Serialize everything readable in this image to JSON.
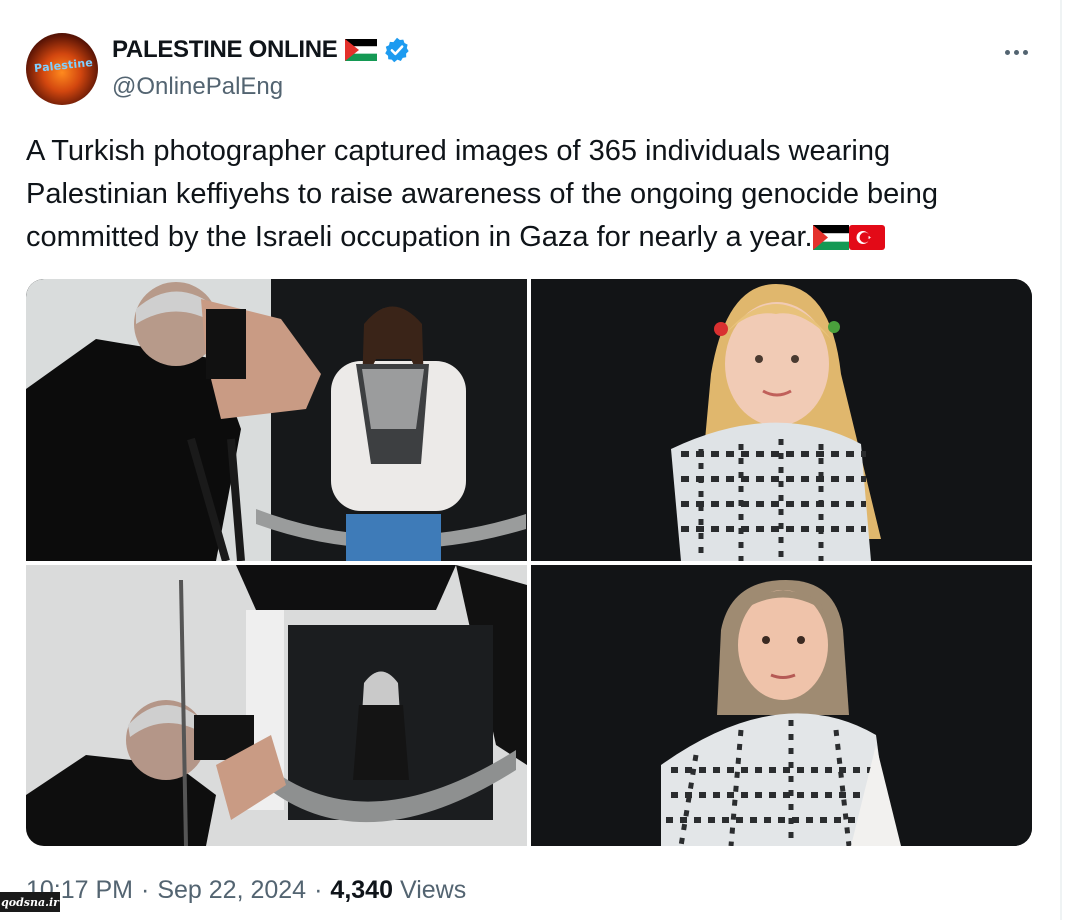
{
  "tweet": {
    "display_name": "PALESTINE ONLINE",
    "handle": "@OnlinePalEng",
    "avatar_text": "Palestine",
    "verified_icon": "verified-badge-icon",
    "name_flag": "palestine-flag",
    "text": "A Turkish photographer captured images of 365 individuals wearing Palestinian keffiyehs to raise awareness of the ongoing genocide being committed by the Israeli occupation in Gaza for nearly a year.",
    "text_flags": [
      "palestine-flag",
      "turkey-flag"
    ],
    "photos": [
      {
        "subject": "photographer shooting young man in keffiyeh"
      },
      {
        "subject": "blonde girl in keffiyeh"
      },
      {
        "subject": "photographer shooting woman in hijab and keffiyeh"
      },
      {
        "subject": "woman in hijab and keffiyeh"
      }
    ],
    "time": "10:17 PM",
    "date": "Sep 22, 2024",
    "separator": "·",
    "views_count": "4,340",
    "views_label": "Views",
    "watermark": "qodsna.ir"
  },
  "colors": {
    "text_primary": "#0f1419",
    "text_secondary": "#536471",
    "verified_blue": "#1d9bf0",
    "flag_green": "#149954",
    "flag_red": "#e4312b",
    "turkey_red": "#e30a17"
  }
}
